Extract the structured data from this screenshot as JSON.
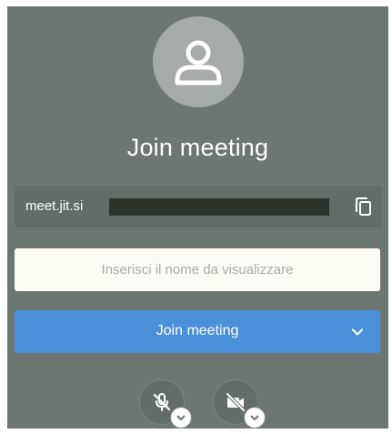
{
  "prejoin": {
    "title": "Join meeting",
    "url_text": "meet.jit.si",
    "name_placeholder": "Inserisci il nome da visualizzare",
    "name_value": "",
    "join_label": "Join meeting"
  },
  "icons": {
    "avatar": "user-icon",
    "copy": "copy-icon",
    "join_options": "chevron-down-icon",
    "microphone": "microphone-off-icon",
    "camera": "camera-off-icon",
    "mic_options": "chevron-down-icon",
    "camera_options": "chevron-down-icon"
  },
  "colors": {
    "panel_background": "#6d7772",
    "primary_button": "#4a90d9",
    "input_background": "#fcfcf4"
  }
}
